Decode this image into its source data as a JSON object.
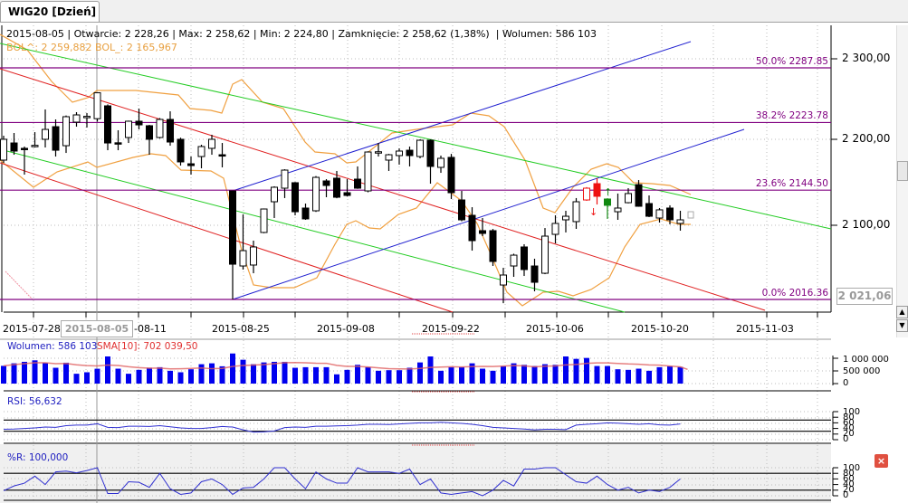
{
  "tab": {
    "title": "WIG20 [Dzień]"
  },
  "info": {
    "date": "2015-08-05",
    "open": "Otwarcie: 2 228,26",
    "max": "Max: 2 258,62",
    "min": "Min: 2 224,80",
    "close": "Zamknięcie: 2 258,62 (1,38%)",
    "volume": "Wolumen: 586 103",
    "bol_upper": "BOL^: 2 259,882",
    "bol_lower": "BOL_: 2 165,967"
  },
  "price_axis": {
    "labels": [
      "2 300,00",
      "2 200,00",
      "2 100,00"
    ],
    "cursor_price": "2 021,06"
  },
  "date_axis": {
    "labels": [
      "2015-07-28",
      "-08-11",
      "2015-08-25",
      "2015-09-08",
      "2015-09-22",
      "2015-10-06",
      "2015-10-20",
      "2015-11-03"
    ],
    "cursor_date": "2015-08-05"
  },
  "fibonacci": [
    {
      "label": "50.0% 2287.85",
      "value": 2287.85
    },
    {
      "label": "38.2% 2223.78",
      "value": 2223.78
    },
    {
      "label": "23.6% 2144.50",
      "value": 2144.5
    },
    {
      "label": "0.0% 2016.36",
      "value": 2016.36
    }
  ],
  "volume_panel": {
    "label": "Wolumen: 586 103",
    "sma_label": "SMA[10]: 702 039,50",
    "axis": [
      "1 000 000",
      "500 000",
      "0"
    ]
  },
  "rsi_panel": {
    "label": "RSI: 56,632",
    "axis": [
      "100",
      "80",
      "60",
      "40",
      "20",
      "0"
    ]
  },
  "wr_panel": {
    "label": "%R: 100,000",
    "axis": [
      "100",
      "80",
      "60",
      "40",
      "20",
      "0"
    ]
  },
  "colors": {
    "up_alert": "#ee1111",
    "down_alert": "#118811",
    "volume": "#0000ee",
    "sma": "#e05050",
    "fib": "#800080",
    "bollinger": "#f0a040"
  },
  "chart_data": {
    "type": "candlestick",
    "title": "WIG20 [Dzień]",
    "ylim": [
      2000,
      2320
    ],
    "candles": [
      [
        2179.7,
        2208.3,
        2176.5,
        2204.1
      ],
      [
        2199.8,
        2211.5,
        2186.0,
        2190.3
      ],
      [
        2193.5,
        2195.6,
        2162.7,
        2192.5
      ],
      [
        2196.0,
        2212.5,
        2194.5,
        2197.0
      ],
      [
        2204.1,
        2239.1,
        2194.5,
        2215.7
      ],
      [
        2218.9,
        2227.4,
        2183.9,
        2191.3
      ],
      [
        2196.6,
        2232.0,
        2188.1,
        2230.6
      ],
      [
        2224.2,
        2235.9,
        2218.9,
        2232.7
      ],
      [
        2230.0,
        2234.8,
        2217.9,
        2231.0
      ],
      [
        2228.26,
        2258.62,
        2224.8,
        2258.62
      ],
      [
        2243.3,
        2245.0,
        2191.3,
        2199.8
      ],
      [
        2200.0,
        2214.7,
        2191.3,
        2199.0
      ],
      [
        2206.2,
        2226.0,
        2199.8,
        2225.3
      ],
      [
        2225.3,
        2240.1,
        2215.7,
        2221.0
      ],
      [
        2220.0,
        2221.0,
        2186.0,
        2204.1
      ],
      [
        2206.2,
        2229.0,
        2205.0,
        2227.4
      ],
      [
        2227.4,
        2236.9,
        2196.6,
        2200.9
      ],
      [
        2204.1,
        2206.0,
        2173.3,
        2177.6
      ],
      [
        2175.4,
        2183.9,
        2162.7,
        2173.3
      ],
      [
        2183.9,
        2197.7,
        2170.1,
        2195.6
      ],
      [
        2193.5,
        2209.4,
        2186.0,
        2204.1
      ],
      [
        2186.0,
        2199.8,
        2171.2,
        2185.0
      ],
      [
        2143.6,
        2144.0,
        2016.36,
        2057.7
      ],
      [
        2055.6,
        2116.0,
        2051.4,
        2073.6
      ],
      [
        2056.7,
        2085.3,
        2047.1,
        2077.9
      ],
      [
        2094.9,
        2123.0,
        2094.0,
        2122.4
      ],
      [
        2130.9,
        2149.0,
        2111.8,
        2147.9
      ],
      [
        2146.8,
        2169.0,
        2135.2,
        2168.0
      ],
      [
        2153.2,
        2154.0,
        2115.0,
        2119.2
      ],
      [
        2123.5,
        2128.8,
        2109.7,
        2110.8
      ],
      [
        2120.3,
        2161.0,
        2119.0,
        2159.5
      ],
      [
        2155.3,
        2157.4,
        2136.2,
        2150.0
      ],
      [
        2158.5,
        2167.0,
        2135.0,
        2136.2
      ],
      [
        2141.5,
        2157.4,
        2137.0,
        2138.3
      ],
      [
        2157.4,
        2172.3,
        2146.0,
        2146.8
      ],
      [
        2143.6,
        2190.0,
        2142.0,
        2189.2
      ],
      [
        2189.0,
        2199.8,
        2183.9,
        2189.5
      ],
      [
        2179.7,
        2187.0,
        2167.0,
        2186.0
      ],
      [
        2185.0,
        2193.5,
        2174.4,
        2190.3
      ],
      [
        2191.3,
        2195.6,
        2172.3,
        2185.0
      ],
      [
        2183.9,
        2204.0,
        2181.8,
        2203.0
      ],
      [
        2203.0,
        2204.0,
        2152.1,
        2172.3
      ],
      [
        2171.2,
        2185.0,
        2164.8,
        2181.8
      ],
      [
        2182.9,
        2187.0,
        2134.1,
        2141.5
      ],
      [
        2133.0,
        2143.6,
        2108.0,
        2109.7
      ],
      [
        2115.0,
        2124.5,
        2073.6,
        2085.3
      ],
      [
        2097.0,
        2111.8,
        2090.6,
        2093.8
      ],
      [
        2097.0,
        2099.0,
        2055.6,
        2060.9
      ],
      [
        2033.3,
        2053.5,
        2012.0,
        2045.0
      ],
      [
        2055.6,
        2070.0,
        2042.9,
        2068.3
      ],
      [
        2077.9,
        2081.1,
        2043.9,
        2051.4
      ],
      [
        2055.6,
        2064.1,
        2025.9,
        2036.5
      ],
      [
        2047.1,
        2100.1,
        2046.0,
        2090.6
      ],
      [
        2092.7,
        2115.0,
        2082.1,
        2105.5
      ],
      [
        2109.7,
        2120.3,
        2094.9,
        2113.9
      ],
      [
        2107.6,
        2135.2,
        2099.1,
        2130.9
      ],
      [
        2133.0,
        2148.0,
        2132.0,
        2146.8
      ],
      [
        2152.1,
        2158.5,
        2127.7,
        2137.3
      ],
      [
        2134.1,
        2135.0,
        2110.8,
        2126.7
      ],
      [
        2119.2,
        2140.5,
        2109.7,
        2123.5
      ],
      [
        2129.8,
        2146.8,
        2129.0,
        2140.5
      ],
      [
        2151.0,
        2156.3,
        2125.0,
        2125.6
      ],
      [
        2128.8,
        2138.3,
        2112.9,
        2113.9
      ],
      [
        2111.8,
        2123.5,
        2106.5,
        2121.4
      ],
      [
        2123.5,
        2126.7,
        2104.4,
        2109.7
      ],
      [
        2105.5,
        2120.3,
        2097.0,
        2109.7
      ]
    ],
    "candle_fields": [
      "open",
      "high",
      "low",
      "close"
    ],
    "highlight": {
      "56": "red-outline",
      "57": "red",
      "58": "green"
    },
    "volume": [
      700,
      800,
      859,
      918,
      824,
      624,
      824,
      388,
      447,
      586.103,
      1071,
      588,
      388,
      541,
      624,
      647,
      506,
      447,
      565,
      765,
      800,
      682,
      1188,
      941,
      765,
      835,
      859,
      859,
      624,
      647,
      647,
      647,
      365,
      541,
      741,
      647,
      506,
      529,
      529,
      624,
      835,
      1071,
      506,
      647,
      647,
      800,
      588,
      506,
      682,
      800,
      741,
      694,
      765,
      741,
      1071,
      976,
      1012,
      694,
      694,
      565,
      541,
      588,
      506,
      647,
      682,
      660
    ],
    "volume_units": "thousands",
    "rsi": [
      37,
      38,
      40,
      42,
      45,
      44,
      50,
      52,
      52,
      56.632,
      44,
      43,
      48,
      48,
      47,
      50,
      46,
      42,
      40,
      40,
      43,
      47,
      45,
      35,
      27,
      28,
      31,
      43,
      45,
      44,
      48,
      48,
      49,
      50,
      52,
      55,
      55,
      54,
      56,
      58,
      60,
      60,
      62,
      60,
      58,
      55,
      50,
      44,
      42,
      40,
      38,
      35,
      37,
      37,
      36,
      52,
      55,
      57,
      60,
      59,
      57,
      55,
      57,
      53,
      52,
      56
    ],
    "williams_r": [
      18,
      35,
      45,
      70,
      40,
      85,
      88,
      82,
      90,
      100,
      8,
      8,
      50,
      48,
      30,
      80,
      25,
      5,
      10,
      50,
      60,
      40,
      5,
      28,
      30,
      60,
      100,
      100,
      60,
      25,
      85,
      60,
      45,
      45,
      100,
      85,
      85,
      85,
      80,
      95,
      40,
      60,
      10,
      5,
      10,
      15,
      0,
      20,
      55,
      35,
      95,
      95,
      100,
      100,
      75,
      50,
      45,
      70,
      40,
      20,
      30,
      10,
      20,
      15,
      30,
      60
    ]
  }
}
